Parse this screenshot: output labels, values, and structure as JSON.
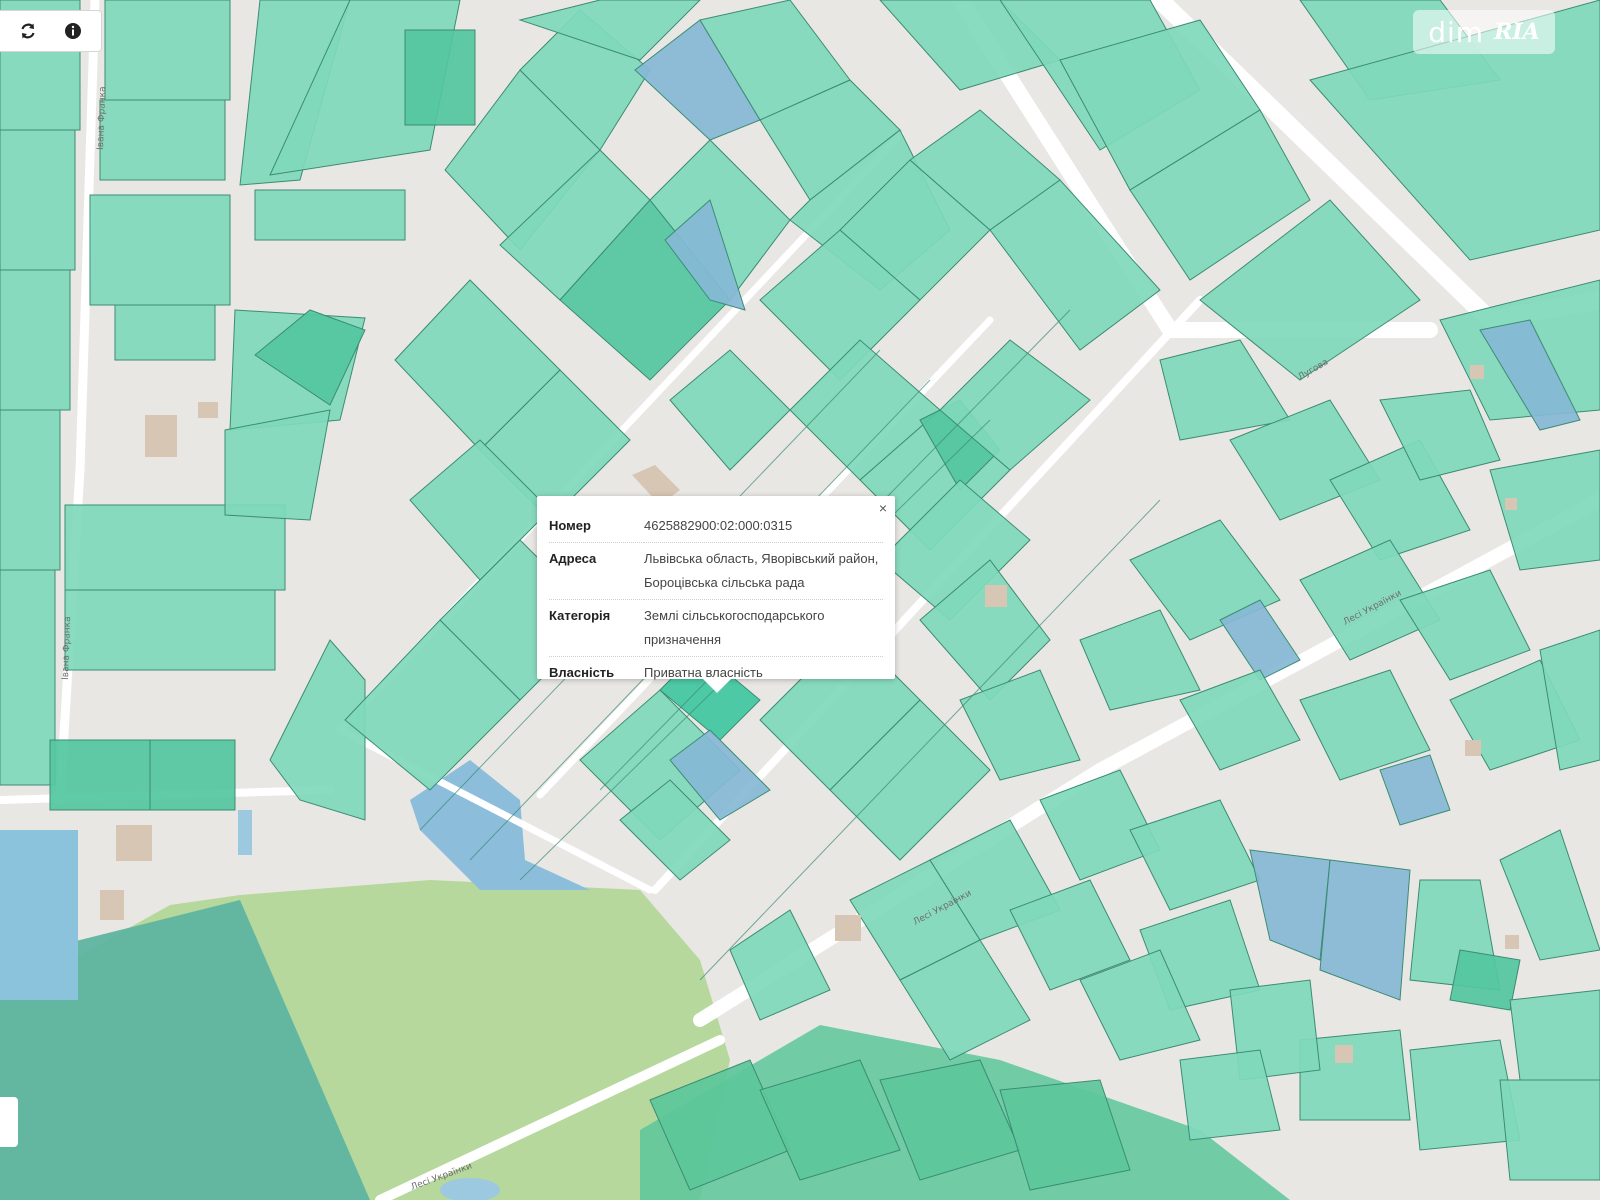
{
  "toolbar": {
    "refresh_icon": "refresh-icon",
    "info_icon": "info-icon"
  },
  "watermark": {
    "text": "dim",
    "logo": "RIA"
  },
  "popup": {
    "close_label": "×",
    "rows": [
      {
        "key": "Номер",
        "value": "4625882900:02:000:0315"
      },
      {
        "key": "Адреса",
        "value": "Львівська область, Яворівський район, Бороцівська сільська рада"
      },
      {
        "key": "Категорія",
        "value": "Землі сільськогосподарського призначення"
      },
      {
        "key": "Власність",
        "value": "Приватна власність"
      }
    ]
  },
  "colors": {
    "parcel": "#7fd9bb",
    "parcel_dark": "#52c7a0",
    "parcel_blue": "#86b9d6",
    "forest": "#b3d69a",
    "forest_dark": "#5fb39b",
    "water": "#8cc3dc",
    "road": "#ffffff",
    "ground": "#e8e6e3",
    "building": "#d8c6b4"
  }
}
